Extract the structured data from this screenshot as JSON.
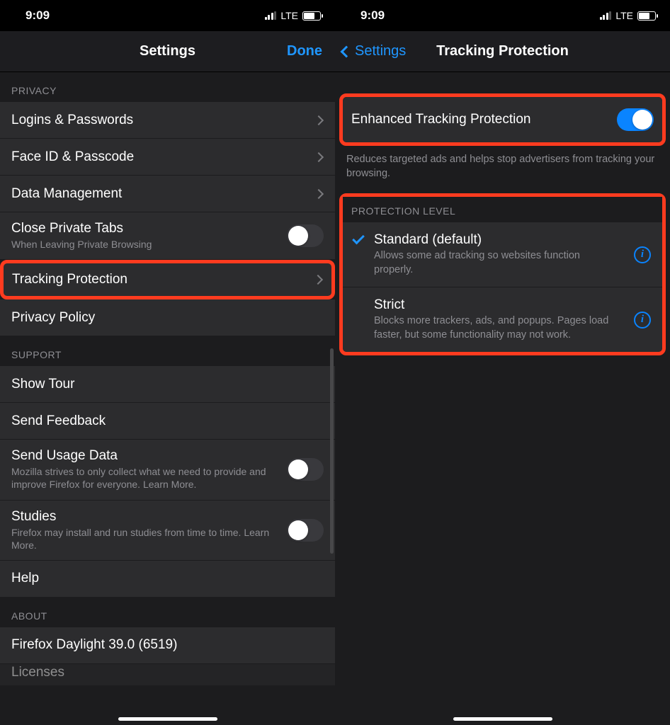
{
  "statusbar": {
    "time": "9:09",
    "carrier": "LTE"
  },
  "left": {
    "nav": {
      "title": "Settings",
      "done": "Done"
    },
    "privacyHeader": "PRIVACY",
    "privacy": {
      "logins": "Logins & Passwords",
      "faceid": "Face ID & Passcode",
      "data": "Data Management",
      "closeTabs": "Close Private Tabs",
      "closeTabsSub": "When Leaving Private Browsing",
      "tracking": "Tracking Protection",
      "policy": "Privacy Policy"
    },
    "supportHeader": "SUPPORT",
    "support": {
      "tour": "Show Tour",
      "feedback": "Send Feedback",
      "usage": "Send Usage Data",
      "usageSub": "Mozilla strives to only collect what we need to provide and improve Firefox for everyone. Learn More.",
      "studies": "Studies",
      "studiesSub": "Firefox may install and run studies from time to time. Learn More.",
      "help": "Help"
    },
    "aboutHeader": "ABOUT",
    "about": {
      "version": "Firefox Daylight 39.0 (6519)",
      "licenses": "Licenses"
    }
  },
  "right": {
    "nav": {
      "back": "Settings",
      "title": "Tracking Protection"
    },
    "etp": {
      "title": "Enhanced Tracking Protection",
      "footer": "Reduces targeted ads and helps stop advertisers from tracking your browsing."
    },
    "levelHeader": "PROTECTION LEVEL",
    "standard": {
      "title": "Standard (default)",
      "sub": "Allows some ad tracking so websites function properly."
    },
    "strict": {
      "title": "Strict",
      "sub": "Blocks more trackers, ads, and popups. Pages load faster, but some functionality may not work."
    }
  }
}
